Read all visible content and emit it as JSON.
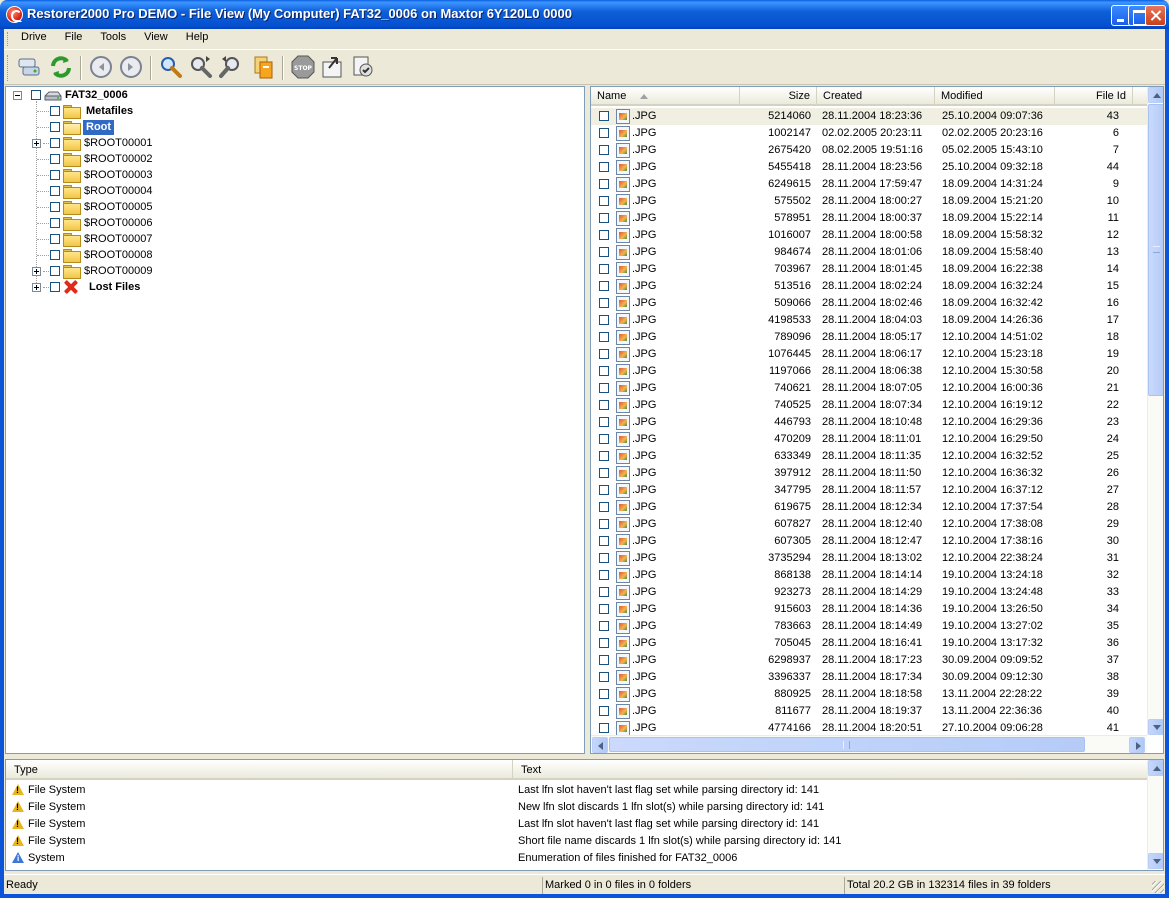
{
  "window": {
    "title": "Restorer2000 Pro DEMO - File View (My Computer) FAT32_0006 on Maxtor 6Y120L0 0000"
  },
  "menu": [
    "Drive",
    "File",
    "Tools",
    "View",
    "Help"
  ],
  "toolbar": {
    "buttons": [
      "drives-icon",
      "refresh-icon",
      "back-icon",
      "forward-icon",
      "find-icon",
      "find-next-icon",
      "find-prev-icon",
      "mask-icon",
      "stop-icon",
      "recover-icon",
      "recover-marked-icon"
    ]
  },
  "tree": {
    "root": "FAT32_0006",
    "items": [
      {
        "label": "Metafiles",
        "bold": true
      },
      {
        "label": "Root",
        "bold": true,
        "selected": true
      },
      {
        "label": "$ROOT00001"
      },
      {
        "label": "$ROOT00002"
      },
      {
        "label": "$ROOT00003"
      },
      {
        "label": "$ROOT00004"
      },
      {
        "label": "$ROOT00005"
      },
      {
        "label": "$ROOT00006"
      },
      {
        "label": "$ROOT00007"
      },
      {
        "label": "$ROOT00008"
      },
      {
        "label": "$ROOT00009"
      },
      {
        "label": "Lost Files",
        "bold": true
      }
    ]
  },
  "list": {
    "columns": [
      "Name",
      "Size",
      "Created",
      "Modified",
      "File Id",
      ""
    ],
    "rows": [
      [
        ".JPG",
        "5214060",
        "28.11.2004 18:23:36",
        "25.10.2004 09:07:36",
        "43"
      ],
      [
        ".JPG",
        "1002147",
        "02.02.2005 20:23:11",
        "02.02.2005 20:23:16",
        "6"
      ],
      [
        ".JPG",
        "2675420",
        "08.02.2005 19:51:16",
        "05.02.2005 15:43:10",
        "7"
      ],
      [
        ".JPG",
        "5455418",
        "28.11.2004 18:23:56",
        "25.10.2004 09:32:18",
        "44"
      ],
      [
        ".JPG",
        "6249615",
        "28.11.2004 17:59:47",
        "18.09.2004 14:31:24",
        "9"
      ],
      [
        ".JPG",
        "575502",
        "28.11.2004 18:00:27",
        "18.09.2004 15:21:20",
        "10"
      ],
      [
        ".JPG",
        "578951",
        "28.11.2004 18:00:37",
        "18.09.2004 15:22:14",
        "11"
      ],
      [
        ".JPG",
        "1016007",
        "28.11.2004 18:00:58",
        "18.09.2004 15:58:32",
        "12"
      ],
      [
        ".JPG",
        "984674",
        "28.11.2004 18:01:06",
        "18.09.2004 15:58:40",
        "13"
      ],
      [
        ".JPG",
        "703967",
        "28.11.2004 18:01:45",
        "18.09.2004 16:22:38",
        "14"
      ],
      [
        ".JPG",
        "513516",
        "28.11.2004 18:02:24",
        "18.09.2004 16:32:24",
        "15"
      ],
      [
        ".JPG",
        "509066",
        "28.11.2004 18:02:46",
        "18.09.2004 16:32:42",
        "16"
      ],
      [
        ".JPG",
        "4198533",
        "28.11.2004 18:04:03",
        "18.09.2004 14:26:36",
        "17"
      ],
      [
        ".JPG",
        "789096",
        "28.11.2004 18:05:17",
        "12.10.2004 14:51:02",
        "18"
      ],
      [
        ".JPG",
        "1076445",
        "28.11.2004 18:06:17",
        "12.10.2004 15:23:18",
        "19"
      ],
      [
        ".JPG",
        "1197066",
        "28.11.2004 18:06:38",
        "12.10.2004 15:30:58",
        "20"
      ],
      [
        ".JPG",
        "740621",
        "28.11.2004 18:07:05",
        "12.10.2004 16:00:36",
        "21"
      ],
      [
        ".JPG",
        "740525",
        "28.11.2004 18:07:34",
        "12.10.2004 16:19:12",
        "22"
      ],
      [
        ".JPG",
        "446793",
        "28.11.2004 18:10:48",
        "12.10.2004 16:29:36",
        "23"
      ],
      [
        ".JPG",
        "470209",
        "28.11.2004 18:11:01",
        "12.10.2004 16:29:50",
        "24"
      ],
      [
        ".JPG",
        "633349",
        "28.11.2004 18:11:35",
        "12.10.2004 16:32:52",
        "25"
      ],
      [
        ".JPG",
        "397912",
        "28.11.2004 18:11:50",
        "12.10.2004 16:36:32",
        "26"
      ],
      [
        ".JPG",
        "347795",
        "28.11.2004 18:11:57",
        "12.10.2004 16:37:12",
        "27"
      ],
      [
        ".JPG",
        "619675",
        "28.11.2004 18:12:34",
        "12.10.2004 17:37:54",
        "28"
      ],
      [
        ".JPG",
        "607827",
        "28.11.2004 18:12:40",
        "12.10.2004 17:38:08",
        "29"
      ],
      [
        ".JPG",
        "607305",
        "28.11.2004 18:12:47",
        "12.10.2004 17:38:16",
        "30"
      ],
      [
        ".JPG",
        "3735294",
        "28.11.2004 18:13:02",
        "12.10.2004 22:38:24",
        "31"
      ],
      [
        ".JPG",
        "868138",
        "28.11.2004 18:14:14",
        "19.10.2004 13:24:18",
        "32"
      ],
      [
        ".JPG",
        "923273",
        "28.11.2004 18:14:29",
        "19.10.2004 13:24:48",
        "33"
      ],
      [
        ".JPG",
        "915603",
        "28.11.2004 18:14:36",
        "19.10.2004 13:26:50",
        "34"
      ],
      [
        ".JPG",
        "783663",
        "28.11.2004 18:14:49",
        "19.10.2004 13:27:02",
        "35"
      ],
      [
        ".JPG",
        "705045",
        "28.11.2004 18:16:41",
        "19.10.2004 13:17:32",
        "36"
      ],
      [
        ".JPG",
        "6298937",
        "28.11.2004 18:17:23",
        "30.09.2004 09:09:52",
        "37"
      ],
      [
        ".JPG",
        "3396337",
        "28.11.2004 18:17:34",
        "30.09.2004 09:12:30",
        "38"
      ],
      [
        ".JPG",
        "880925",
        "28.11.2004 18:18:58",
        "13.11.2004 22:28:22",
        "39"
      ],
      [
        ".JPG",
        "811677",
        "28.11.2004 18:19:37",
        "13.11.2004 22:36:36",
        "40"
      ],
      [
        ".JPG",
        "4774166",
        "28.11.2004 18:20:51",
        "27.10.2004 09:06:28",
        "41"
      ]
    ]
  },
  "log": {
    "columns": [
      "Type",
      "Text"
    ],
    "rows": [
      {
        "icon": "warning-icon",
        "type": "File System",
        "text": "Last lfn slot haven't last flag set while parsing directory id: 141"
      },
      {
        "icon": "warning-icon",
        "type": "File System",
        "text": "New lfn slot discards 1 lfn slot(s) while parsing directory id: 141"
      },
      {
        "icon": "warning-icon",
        "type": "File System",
        "text": "Last lfn slot haven't last flag set while parsing directory id: 141"
      },
      {
        "icon": "warning-icon",
        "type": "File System",
        "text": "Short file name discards 1 lfn slot(s) while parsing directory id: 141"
      },
      {
        "icon": "info-icon",
        "type": "System",
        "text": "Enumeration of files finished for FAT32_0006"
      }
    ]
  },
  "status": {
    "state": "Ready",
    "marked": "Marked 0 in 0 files in 0 folders",
    "total": "Total 20.2 GB in 132314 files in 39 folders"
  },
  "colors": {
    "title_bar": "#0550d0",
    "selection": "#316ac5",
    "window_bg": "#ece9d8"
  }
}
